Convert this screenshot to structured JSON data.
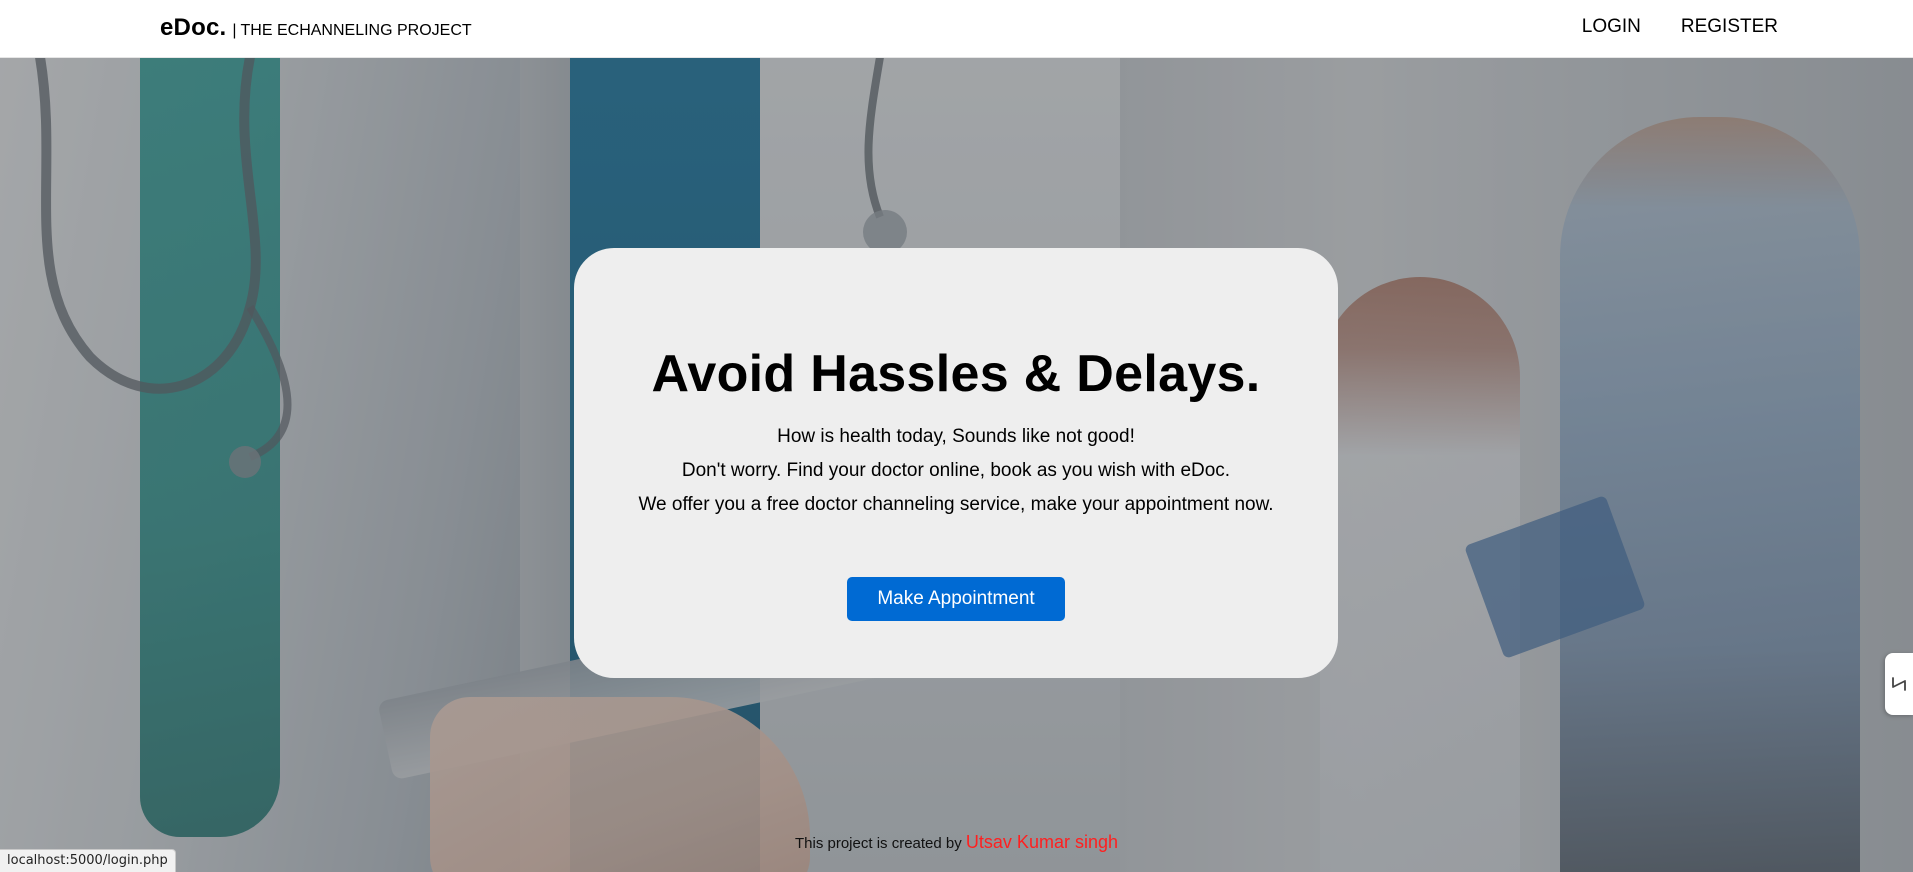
{
  "navbar": {
    "brand_name": "eDoc.",
    "brand_separator": "|",
    "brand_tagline": "THE ECHANNELING PROJECT",
    "links": [
      {
        "label": "LOGIN"
      },
      {
        "label": "REGISTER"
      }
    ]
  },
  "hero": {
    "title": "Avoid Hassles & Delays.",
    "lines": [
      "How is health today, Sounds like not good!",
      "Don't worry. Find your doctor online, book as you wish with eDoc.",
      "We offer you a free doctor channeling service, make your appointment now."
    ],
    "button_label": "Make Appointment"
  },
  "footer": {
    "credit_prefix": "This project is created by",
    "credit_name": "Utsav Kumar singh"
  },
  "status_bar": {
    "url": "localhost:5000/login.php"
  },
  "colors": {
    "button_bg": "#006ad3",
    "card_bg": "#eeeeee",
    "credit_name": "#ff2020"
  },
  "icons": {
    "side_tab": "resize-handle-icon"
  }
}
